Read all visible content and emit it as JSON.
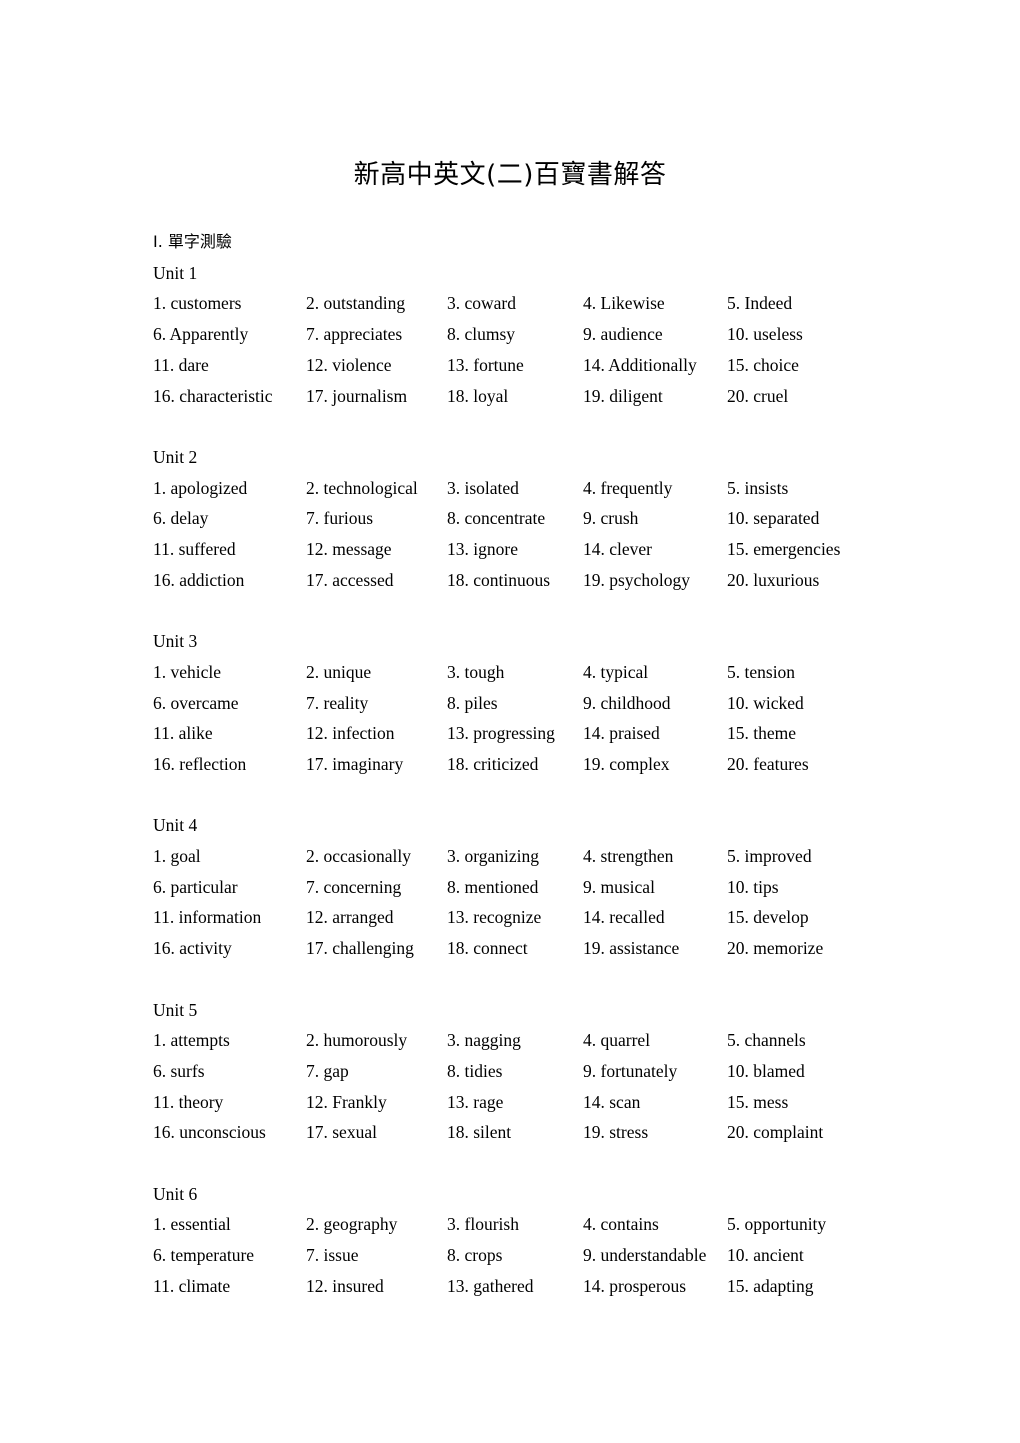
{
  "document": {
    "title": "新高中英文(二)百寶書解答",
    "section_heading": "I. 單字測驗"
  },
  "units": [
    {
      "label": "Unit 1",
      "rows": [
        [
          "1. customers",
          "2. outstanding",
          "3. coward",
          "4. Likewise",
          "5. Indeed"
        ],
        [
          "6. Apparently",
          "7. appreciates",
          "8. clumsy",
          "9. audience",
          "10. useless"
        ],
        [
          "11. dare",
          "12. violence",
          "13. fortune",
          "14. Additionally",
          "15. choice"
        ],
        [
          "16. characteristic",
          "17. journalism",
          "18. loyal",
          "19. diligent",
          "20. cruel"
        ]
      ]
    },
    {
      "label": "Unit 2",
      "rows": [
        [
          "1. apologized",
          "2. technological",
          "3. isolated",
          "4. frequently",
          "5. insists"
        ],
        [
          "6. delay",
          "7. furious",
          "8. concentrate",
          "9. crush",
          "10. separated"
        ],
        [
          "11. suffered",
          "12. message",
          "13. ignore",
          "14. clever",
          "15. emergencies"
        ],
        [
          "16. addiction",
          "17. accessed",
          "18. continuous",
          "19. psychology",
          "20. luxurious"
        ]
      ]
    },
    {
      "label": "Unit 3",
      "rows": [
        [
          "1. vehicle",
          "2. unique",
          "3. tough",
          "4. typical",
          "5. tension"
        ],
        [
          "6. overcame",
          "7. reality",
          "8. piles",
          "9. childhood",
          "10. wicked"
        ],
        [
          "11. alike",
          "12. infection",
          "13. progressing",
          "14. praised",
          "15. theme"
        ],
        [
          "16. reflection",
          "17. imaginary",
          "18. criticized",
          "19. complex",
          "20. features"
        ]
      ]
    },
    {
      "label": "Unit 4",
      "rows": [
        [
          "1. goal",
          "2. occasionally",
          "3. organizing",
          "4. strengthen",
          "5. improved"
        ],
        [
          "6. particular",
          "7. concerning",
          "8. mentioned",
          "9. musical",
          "10. tips"
        ],
        [
          "11. information",
          "12. arranged",
          "13. recognize",
          "14. recalled",
          "15. develop"
        ],
        [
          "16. activity",
          "17. challenging",
          "18. connect",
          "19. assistance",
          "20. memorize"
        ]
      ]
    },
    {
      "label": "Unit 5",
      "rows": [
        [
          "1. attempts",
          "2. humorously",
          "3. nagging",
          "4. quarrel",
          "5. channels"
        ],
        [
          "6. surfs",
          "7. gap",
          "8. tidies",
          "9. fortunately",
          "10. blamed"
        ],
        [
          "11. theory",
          "12. Frankly",
          "13. rage",
          "14. scan",
          "15. mess"
        ],
        [
          "16. unconscious",
          "17. sexual",
          "18. silent",
          "19. stress",
          "20. complaint"
        ]
      ]
    },
    {
      "label": "Unit 6",
      "rows": [
        [
          "1. essential",
          "2. geography",
          "3. flourish",
          "4. contains",
          "5. opportunity"
        ],
        [
          "6. temperature",
          "7. issue",
          "8. crops",
          "9. understandable",
          "10. ancient"
        ],
        [
          "11. climate",
          "12. insured",
          "13. gathered",
          "14. prosperous",
          "15. adapting"
        ]
      ]
    }
  ]
}
